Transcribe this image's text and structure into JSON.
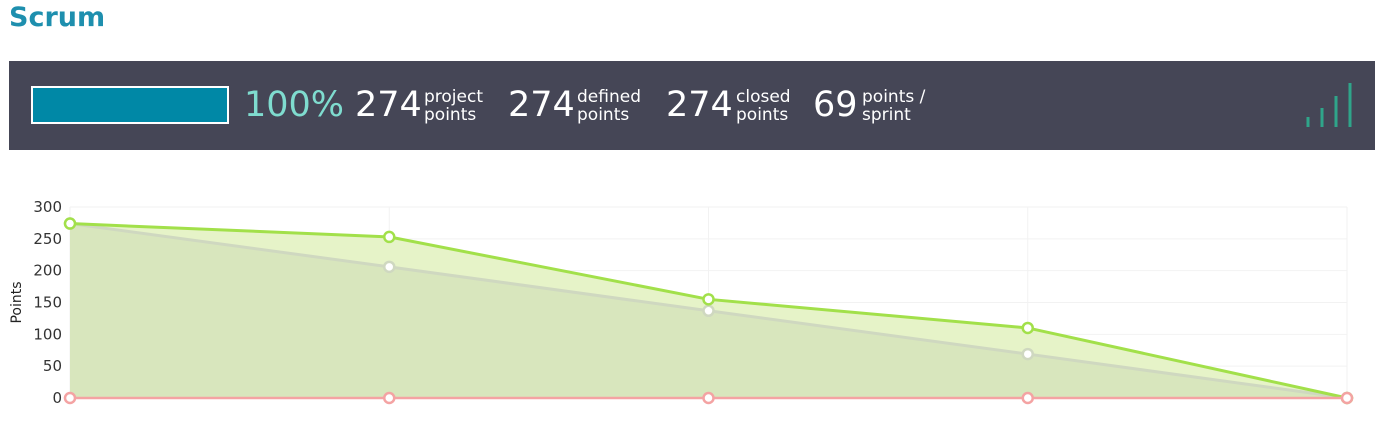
{
  "header": {
    "title": "Scrum"
  },
  "summary": {
    "progress_value": 1.0,
    "progress_label": "100%",
    "project_points": {
      "value": "274",
      "label_line1": "project",
      "label_line2": "points"
    },
    "defined_points": {
      "value": "274",
      "label_line1": "defined",
      "label_line2": "points"
    },
    "closed_points": {
      "value": "274",
      "label_line1": "closed",
      "label_line2": "points"
    },
    "points_per_sprint": {
      "value": "69",
      "label_line1": "points /",
      "label_line2": "sprint"
    },
    "icon": "bar-chart-icon"
  },
  "colors": {
    "title": "#1e8fae",
    "bar_background": "#454656",
    "progress_fill": "#0088a6",
    "percent_text": "#7fdccf",
    "icon": "#2fa58a",
    "actual_line": "#a2e04a",
    "actual_fill": "#e6f3c8",
    "ideal_line": "#cfd8c0",
    "ideal_fill": "#d8e6bd",
    "zero_line": "#f4a3a3"
  },
  "chart_data": {
    "type": "area",
    "ylabel": "Points",
    "xlabel": "",
    "title": "",
    "ylim": [
      0,
      300
    ],
    "yticks": [
      0,
      50,
      100,
      150,
      200,
      250,
      300
    ],
    "x": [
      0,
      1,
      2,
      3,
      4
    ],
    "series": [
      {
        "values": [
          274,
          253,
          155,
          110,
          0
        ],
        "style": "actual"
      },
      {
        "values": [
          274,
          206,
          137,
          69,
          0
        ],
        "style": "ideal"
      },
      {
        "values": [
          0,
          0,
          0,
          0,
          0
        ],
        "style": "zero"
      }
    ],
    "grid": true,
    "legend": "none"
  }
}
